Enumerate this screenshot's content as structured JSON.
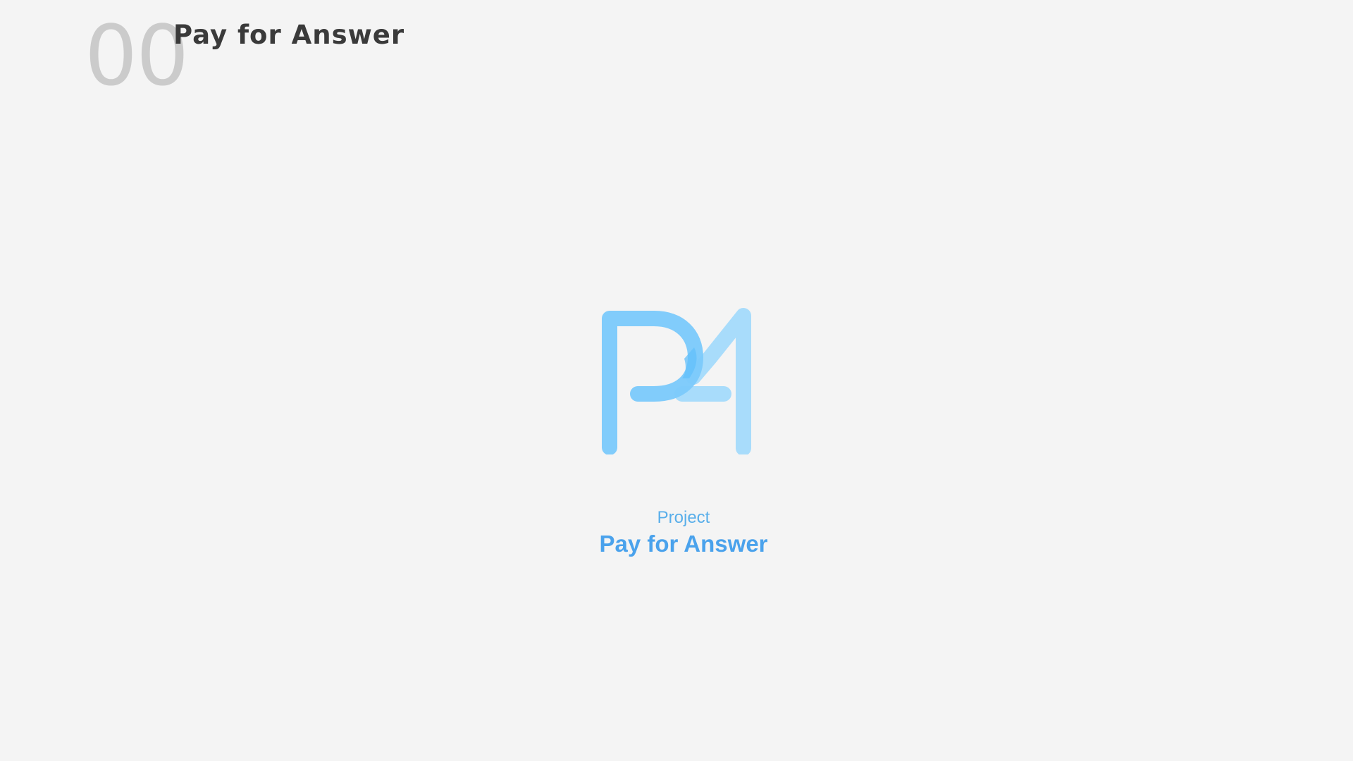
{
  "header": {
    "section_number": "00",
    "title": "Pay for Answer"
  },
  "logo": {
    "name": "P4 logo",
    "colors": {
      "p_shape": "#7dcafb",
      "four_shape": "#a8dcfb"
    }
  },
  "caption": {
    "kicker": "Project",
    "title": "Pay for Answer"
  },
  "colors": {
    "background": "#f4f4f4",
    "number": "#cbcbcb",
    "heading": "#3a3a3a",
    "accent": "#4aa2ec"
  }
}
